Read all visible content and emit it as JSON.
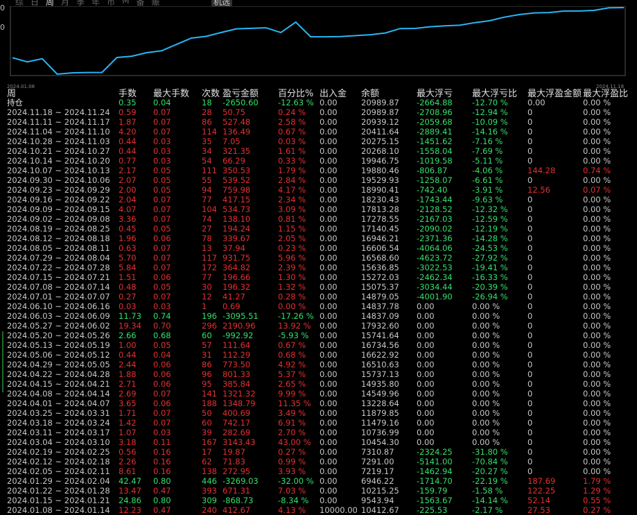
{
  "tabs": [
    "综",
    "日",
    "周",
    "月",
    "季",
    "年",
    "币",
    "M",
    "备",
    "赈"
  ],
  "active_tab_index": 2,
  "curve_label": "机选",
  "chart": {
    "start_date": "2024.01.08",
    "end_date": "2024.11.18",
    "line_color": "#29b6f6",
    "y_labels": [
      "0",
      "0"
    ]
  },
  "chart_data": {
    "type": "line",
    "x": [
      "2024.01.08",
      "2024.01.15",
      "2024.01.22",
      "2024.01.29",
      "2024.02.05",
      "2024.02.12",
      "2024.02.19",
      "2024.03.04",
      "2024.03.11",
      "2024.03.18",
      "2024.03.25",
      "2024.04.01",
      "2024.04.08",
      "2024.04.15",
      "2024.04.22",
      "2024.04.29",
      "2024.05.06",
      "2024.05.13",
      "2024.05.20",
      "2024.05.27",
      "2024.06.03",
      "2024.06.10",
      "2024.07.01",
      "2024.07.08",
      "2024.07.15",
      "2024.07.22",
      "2024.07.29",
      "2024.08.05",
      "2024.08.12",
      "2024.08.19",
      "2024.09.02",
      "2024.09.09",
      "2024.09.16",
      "2024.09.23",
      "2024.09.30",
      "2024.10.07",
      "2024.10.14",
      "2024.10.21",
      "2024.10.28",
      "2024.11.04",
      "2024.11.11",
      "2024.11.18"
    ],
    "series": [
      {
        "values": [
          10412.67,
          9543.94,
          10215.25,
          6946.22,
          7219.17,
          7291.0,
          7310.87,
          10454.3,
          10736.99,
          11479.16,
          11879.85,
          13228.64,
          14549.96,
          14935.8,
          15737.13,
          16510.63,
          16622.92,
          16734.56,
          15741.64,
          17932.6,
          14837.09,
          14837.78,
          14879.05,
          15075.37,
          15272.03,
          15636.85,
          16568.6,
          16606.54,
          16946.21,
          17140.45,
          17278.55,
          17813.28,
          18230.43,
          18990.41,
          19529.93,
          19880.46,
          19946.75,
          20268.1,
          20275.15,
          20411.64,
          20939.12,
          20989.87
        ]
      }
    ]
  },
  "table": {
    "headers": [
      "周",
      "手数",
      "最大手数",
      "次数",
      "盈亏金额",
      "百分比%",
      "出入金",
      "余额",
      "最大浮亏",
      "最大浮亏比",
      "最大浮盈金额",
      "最大浮盈比"
    ],
    "rows": [
      {
        "cls": "up",
        "fl_c": "g",
        "fp_c": "w",
        "d": "持仓",
        "lot": "0.35",
        "max": "0.04",
        "cnt": "18",
        "pnl": "-2650.60",
        "pct": "-12.63 %",
        "io": "0.00",
        "bal": "20989.87",
        "fl": "-2664.88",
        "flp": "-12.70 %",
        "fp": "0.00",
        "fpp": "0.00 %"
      },
      {
        "cls": "dn",
        "fl_c": "g",
        "fp_c": "w",
        "d": "2024.11.18 ~ 2024.11.24",
        "lot": "0.59",
        "max": "0.07",
        "cnt": "28",
        "pnl": "50.75",
        "pct": "0.24 %",
        "io": "0.00",
        "bal": "20989.87",
        "fl": "-2708.96",
        "flp": "-12.94 %",
        "fp": "0",
        "fpp": "0.00 %"
      },
      {
        "cls": "dn",
        "fl_c": "g",
        "fp_c": "w",
        "d": "2024.11.11 ~ 2024.11.17",
        "lot": "1.87",
        "max": "0.07",
        "cnt": "86",
        "pnl": "527.48",
        "pct": "2.58 %",
        "io": "0.00",
        "bal": "20939.12",
        "fl": "-2059.68",
        "flp": "-10.09 %",
        "fp": "0",
        "fpp": "0.00 %"
      },
      {
        "cls": "dn",
        "fl_c": "g",
        "fp_c": "w",
        "d": "2024.11.04 ~ 2024.11.10",
        "lot": "4.20",
        "max": "0.07",
        "cnt": "114",
        "pnl": "136.49",
        "pct": "0.67 %",
        "io": "0.00",
        "bal": "20411.64",
        "fl": "-2889.41",
        "flp": "-14.16 %",
        "fp": "0",
        "fpp": "0.00 %"
      },
      {
        "cls": "dn",
        "fl_c": "g",
        "fp_c": "w",
        "d": "2024.10.28 ~ 2024.11.03",
        "lot": "0.44",
        "max": "0.03",
        "cnt": "35",
        "pnl": "7.05",
        "pct": "0.03 %",
        "io": "0.00",
        "bal": "20275.15",
        "fl": "-1451.62",
        "flp": "-7.16 %",
        "fp": "0",
        "fpp": "0.00 %"
      },
      {
        "cls": "dn",
        "fl_c": "g",
        "fp_c": "w",
        "d": "2024.10.21 ~ 2024.10.27",
        "lot": "0.44",
        "max": "0.03",
        "cnt": "34",
        "pnl": "321.35",
        "pct": "1.61 %",
        "io": "0.00",
        "bal": "20268.10",
        "fl": "-1558.04",
        "flp": "-7.69 %",
        "fp": "0",
        "fpp": "0.00 %"
      },
      {
        "cls": "dn",
        "fl_c": "g",
        "fp_c": "w",
        "d": "2024.10.14 ~ 2024.10.20",
        "lot": "0.77",
        "max": "0.03",
        "cnt": "54",
        "pnl": "66.29",
        "pct": "0.33 %",
        "io": "0.00",
        "bal": "19946.75",
        "fl": "-1019.58",
        "flp": "-5.11 %",
        "fp": "0",
        "fpp": "0.00 %"
      },
      {
        "cls": "dn",
        "fl_c": "g",
        "fp_c": "r",
        "d": "2024.10.07 ~ 2024.10.13",
        "lot": "2.17",
        "max": "0.05",
        "cnt": "111",
        "pnl": "350.53",
        "pct": "1.79 %",
        "io": "0.00",
        "bal": "19880.46",
        "fl": "-806.87",
        "flp": "-4.06 %",
        "fp": "144.28",
        "fpp": "0.74 %"
      },
      {
        "cls": "dn",
        "fl_c": "g",
        "fp_c": "w",
        "d": "2024.09.30 ~ 2024.10.06",
        "lot": "2.07",
        "max": "0.05",
        "cnt": "55",
        "pnl": "539.52",
        "pct": "2.84 %",
        "io": "0.00",
        "bal": "19529.93",
        "fl": "-1258.07",
        "flp": "-6.61 %",
        "fp": "0",
        "fpp": "0.00 %"
      },
      {
        "cls": "dn",
        "fl_c": "g",
        "fp_c": "r",
        "d": "2024.09.23 ~ 2024.09.29",
        "lot": "2.00",
        "max": "0.05",
        "cnt": "94",
        "pnl": "759.98",
        "pct": "4.17 %",
        "io": "0.00",
        "bal": "18990.41",
        "fl": "-742.40",
        "flp": "-3.91 %",
        "fp": "12.56",
        "fpp": "0.07 %"
      },
      {
        "cls": "dn",
        "fl_c": "g",
        "fp_c": "w",
        "d": "2024.09.16 ~ 2024.09.22",
        "lot": "2.04",
        "max": "0.07",
        "cnt": "77",
        "pnl": "417.15",
        "pct": "2.34 %",
        "io": "0.00",
        "bal": "18230.43",
        "fl": "-1743.44",
        "flp": "-9.63 %",
        "fp": "0",
        "fpp": "0.00 %"
      },
      {
        "cls": "dn",
        "fl_c": "g",
        "fp_c": "w",
        "d": "2024.09.09 ~ 2024.09.15",
        "lot": "4.07",
        "max": "0.07",
        "cnt": "104",
        "pnl": "534.73",
        "pct": "3.09 %",
        "io": "0.00",
        "bal": "17813.28",
        "fl": "-2128.52",
        "flp": "-12.32 %",
        "fp": "0",
        "fpp": "0.00 %"
      },
      {
        "cls": "dn",
        "fl_c": "g",
        "fp_c": "w",
        "d": "2024.09.02 ~ 2024.09.08",
        "lot": "3.36",
        "max": "0.07",
        "cnt": "74",
        "pnl": "138.10",
        "pct": "0.81 %",
        "io": "0.00",
        "bal": "17278.55",
        "fl": "-2167.03",
        "flp": "-12.59 %",
        "fp": "0",
        "fpp": "0.00 %"
      },
      {
        "cls": "dn",
        "fl_c": "g",
        "fp_c": "w",
        "d": "2024.08.19 ~ 2024.08.25",
        "lot": "0.45",
        "max": "0.05",
        "cnt": "27",
        "pnl": "194.24",
        "pct": "1.15 %",
        "io": "0.00",
        "bal": "17140.45",
        "fl": "-2090.02",
        "flp": "-12.19 %",
        "fp": "0",
        "fpp": "0.00 %"
      },
      {
        "cls": "dn",
        "fl_c": "g",
        "fp_c": "w",
        "d": "2024.08.12 ~ 2024.08.18",
        "lot": "1.96",
        "max": "0.06",
        "cnt": "78",
        "pnl": "339.67",
        "pct": "2.05 %",
        "io": "0.00",
        "bal": "16946.21",
        "fl": "-2371.36",
        "flp": "-14.28 %",
        "fp": "0",
        "fpp": "0.00 %"
      },
      {
        "cls": "dn",
        "fl_c": "g",
        "fp_c": "w",
        "d": "2024.08.05 ~ 2024.08.11",
        "lot": "0.63",
        "max": "0.07",
        "cnt": "13",
        "pnl": "37.94",
        "pct": "0.23 %",
        "io": "0.00",
        "bal": "16606.54",
        "fl": "-4064.06",
        "flp": "-24.53 %",
        "fp": "0",
        "fpp": "0.00 %"
      },
      {
        "cls": "dn",
        "fl_c": "g",
        "fp_c": "w",
        "d": "2024.07.29 ~ 2024.08.04",
        "lot": "5.70",
        "max": "0.07",
        "cnt": "117",
        "pnl": "931.75",
        "pct": "5.96 %",
        "io": "0.00",
        "bal": "16568.60",
        "fl": "-4623.72",
        "flp": "-27.92 %",
        "fp": "0",
        "fpp": "0.00 %"
      },
      {
        "cls": "dn",
        "fl_c": "g",
        "fp_c": "w",
        "d": "2024.07.22 ~ 2024.07.28",
        "lot": "5.84",
        "max": "0.07",
        "cnt": "172",
        "pnl": "364.82",
        "pct": "2.39 %",
        "io": "0.00",
        "bal": "15636.85",
        "fl": "-3022.53",
        "flp": "-19.41 %",
        "fp": "0",
        "fpp": "0.00 %"
      },
      {
        "cls": "dn",
        "fl_c": "g",
        "fp_c": "w",
        "d": "2024.07.15 ~ 2024.07.21",
        "lot": "1.51",
        "max": "0.06",
        "cnt": "77",
        "pnl": "196.66",
        "pct": "1.30 %",
        "io": "0.00",
        "bal": "15272.03",
        "fl": "-2462.34",
        "flp": "-16.33 %",
        "fp": "0",
        "fpp": "0.00 %"
      },
      {
        "cls": "dn",
        "fl_c": "g",
        "fp_c": "w",
        "d": "2024.07.08 ~ 2024.07.14",
        "lot": "0.48",
        "max": "0.05",
        "cnt": "30",
        "pnl": "196.32",
        "pct": "1.32 %",
        "io": "0.00",
        "bal": "15075.37",
        "fl": "-3034.44",
        "flp": "-20.39 %",
        "fp": "0",
        "fpp": "0.00 %"
      },
      {
        "cls": "dn",
        "fl_c": "g",
        "fp_c": "w",
        "d": "2024.07.01 ~ 2024.07.07",
        "lot": "0.27",
        "max": "0.07",
        "cnt": "12",
        "pnl": "41.27",
        "pct": "0.28 %",
        "io": "0.00",
        "bal": "14879.05",
        "fl": "-4001.90",
        "flp": "-26.94 %",
        "fp": "0",
        "fpp": "0.00 %"
      },
      {
        "cls": "dn",
        "fl_c": "w",
        "fp_c": "w",
        "d": "2024.06.10 ~ 2024.06.16",
        "lot": "0.03",
        "max": "0.03",
        "cnt": "1",
        "pnl": "0.69",
        "pct": "0.00 %",
        "io": "0.00",
        "bal": "14837.78",
        "fl": "0.00",
        "flp": "0.00 %",
        "fp": "0",
        "fpp": "0.00 %"
      },
      {
        "cls": "up",
        "fl_c": "w",
        "fp_c": "w",
        "d": "2024.06.03 ~ 2024.06.09",
        "lot": "11.73",
        "max": "0.74",
        "cnt": "196",
        "pnl": "-3095.51",
        "pct": "-17.26 %",
        "io": "0.00",
        "bal": "14837.09",
        "fl": "0.00",
        "flp": "0.00 %",
        "fp": "0",
        "fpp": "0.00 %"
      },
      {
        "cls": "dn",
        "fl_c": "w",
        "fp_c": "w",
        "d": "2024.05.27 ~ 2024.06.02",
        "lot": "19.34",
        "max": "0.70",
        "cnt": "296",
        "pnl": "2190.96",
        "pct": "13.92 %",
        "io": "0.00",
        "bal": "17932.60",
        "fl": "0.00",
        "flp": "0.00 %",
        "fp": "0",
        "fpp": "0.00 %"
      },
      {
        "cls": "up",
        "fl_c": "w",
        "fp_c": "w",
        "d": "2024.05.20 ~ 2024.05.26",
        "lot": "2.66",
        "max": "0.68",
        "cnt": "60",
        "pnl": "-992.92",
        "pct": "-5.93 %",
        "io": "0.00",
        "bal": "15741.64",
        "fl": "0.00",
        "flp": "0.00 %",
        "fp": "0",
        "fpp": "0.00 %"
      },
      {
        "cls": "dn",
        "fl_c": "w",
        "fp_c": "w",
        "d": "2024.05.13 ~ 2024.05.19",
        "lot": "1.00",
        "max": "0.05",
        "cnt": "57",
        "pnl": "111.64",
        "pct": "0.67 %",
        "io": "0.00",
        "bal": "16734.56",
        "fl": "0.00",
        "flp": "0.00 %",
        "fp": "0",
        "fpp": "0.00 %"
      },
      {
        "cls": "dn",
        "fl_c": "w",
        "fp_c": "w",
        "d": "2024.05.06 ~ 2024.05.12",
        "lot": "0.44",
        "max": "0.04",
        "cnt": "31",
        "pnl": "112.29",
        "pct": "0.68 %",
        "io": "0.00",
        "bal": "16622.92",
        "fl": "0.00",
        "flp": "0.00 %",
        "fp": "0",
        "fpp": "0.00 %"
      },
      {
        "cls": "dn",
        "fl_c": "w",
        "fp_c": "w",
        "d": "2024.04.29 ~ 2024.05.05",
        "lot": "2.44",
        "max": "0.06",
        "cnt": "86",
        "pnl": "773.50",
        "pct": "4.92 %",
        "io": "0.00",
        "bal": "16510.63",
        "fl": "0.00",
        "flp": "0.00 %",
        "fp": "0",
        "fpp": "0.00 %"
      },
      {
        "cls": "dn",
        "fl_c": "w",
        "fp_c": "w",
        "d": "2024.04.22 ~ 2024.04.28",
        "lot": "1.88",
        "max": "0.06",
        "cnt": "96",
        "pnl": "801.33",
        "pct": "5.37 %",
        "io": "0.00",
        "bal": "15737.13",
        "fl": "0.00",
        "flp": "0.00 %",
        "fp": "0",
        "fpp": "0.00 %"
      },
      {
        "cls": "dn",
        "fl_c": "w",
        "fp_c": "w",
        "d": "2024.04.15 ~ 2024.04.21",
        "lot": "2.71",
        "max": "0.06",
        "cnt": "95",
        "pnl": "385.84",
        "pct": "2.65 %",
        "io": "0.00",
        "bal": "14935.80",
        "fl": "0.00",
        "flp": "0.00 %",
        "fp": "0",
        "fpp": "0.00 %"
      },
      {
        "cls": "dn",
        "fl_c": "w",
        "fp_c": "w",
        "d": "2024.04.08 ~ 2024.04.14",
        "lot": "2.69",
        "max": "0.07",
        "cnt": "141",
        "pnl": "1321.32",
        "pct": "9.99 %",
        "io": "0.00",
        "bal": "14549.96",
        "fl": "0.00",
        "flp": "0.00 %",
        "fp": "0",
        "fpp": "0.00 %"
      },
      {
        "cls": "dn",
        "fl_c": "w",
        "fp_c": "w",
        "d": "2024.04.01 ~ 2024.04.07",
        "lot": "3.65",
        "max": "0.06",
        "cnt": "188",
        "pnl": "1348.79",
        "pct": "11.35 %",
        "io": "0.00",
        "bal": "13228.64",
        "fl": "0.00",
        "flp": "0.00 %",
        "fp": "0",
        "fpp": "0.00 %"
      },
      {
        "cls": "dn",
        "fl_c": "w",
        "fp_c": "w",
        "d": "2024.03.25 ~ 2024.03.31",
        "lot": "1.71",
        "max": "0.07",
        "cnt": "50",
        "pnl": "400.69",
        "pct": "3.49 %",
        "io": "0.00",
        "bal": "11879.85",
        "fl": "0.00",
        "flp": "0.00 %",
        "fp": "0",
        "fpp": "0.00 %"
      },
      {
        "cls": "dn",
        "fl_c": "w",
        "fp_c": "w",
        "d": "2024.03.18 ~ 2024.03.24",
        "lot": "1.42",
        "max": "0.07",
        "cnt": "60",
        "pnl": "742.17",
        "pct": "6.91 %",
        "io": "0.00",
        "bal": "11479.16",
        "fl": "0.00",
        "flp": "0.00 %",
        "fp": "0",
        "fpp": "0.00 %"
      },
      {
        "cls": "dn",
        "fl_c": "w",
        "fp_c": "w",
        "d": "2024.03.11 ~ 2024.03.17",
        "lot": "1.07",
        "max": "0.03",
        "cnt": "39",
        "pnl": "282.69",
        "pct": "2.70 %",
        "io": "0.00",
        "bal": "10736.99",
        "fl": "0.00",
        "flp": "0.00 %",
        "fp": "0",
        "fpp": "0.00 %"
      },
      {
        "cls": "dn",
        "fl_c": "w",
        "fp_c": "w",
        "d": "2024.03.04 ~ 2024.03.10",
        "lot": "3.18",
        "max": "0.11",
        "cnt": "167",
        "pnl": "3143.43",
        "pct": "43.00 %",
        "io": "0.00",
        "bal": "10454.30",
        "fl": "0.00",
        "flp": "0.00 %",
        "fp": "0",
        "fpp": "0.00 %"
      },
      {
        "cls": "dn",
        "fl_c": "g",
        "fp_c": "w",
        "d": "2024.02.19 ~ 2024.02.25",
        "lot": "0.56",
        "max": "0.16",
        "cnt": "17",
        "pnl": "19.87",
        "pct": "0.27 %",
        "io": "0.00",
        "bal": "7310.87",
        "fl": "-2324.25",
        "flp": "-31.80 %",
        "fp": "0",
        "fpp": "0.00 %"
      },
      {
        "cls": "dn",
        "fl_c": "g",
        "fp_c": "w",
        "d": "2024.02.12 ~ 2024.02.18",
        "lot": "2.26",
        "max": "0.16",
        "cnt": "62",
        "pnl": "71.83",
        "pct": "0.99 %",
        "io": "0.00",
        "bal": "7291.00",
        "fl": "-5141.00",
        "flp": "-70.84 %",
        "fp": "0",
        "fpp": "0.00 %"
      },
      {
        "cls": "dn",
        "fl_c": "g",
        "fp_c": "w",
        "d": "2024.02.05 ~ 2024.02.11",
        "lot": "8.61",
        "max": "0.16",
        "cnt": "138",
        "pnl": "272.95",
        "pct": "3.93 %",
        "io": "0.00",
        "bal": "7219.17",
        "fl": "-1462.94",
        "flp": "-20.27 %",
        "fp": "0",
        "fpp": "0.00 %"
      },
      {
        "cls": "up",
        "fl_c": "g",
        "fp_c": "r",
        "d": "2024.01.29 ~ 2024.02.04",
        "lot": "42.47",
        "max": "0.80",
        "cnt": "446",
        "pnl": "-3269.03",
        "pct": "-32.00 %",
        "io": "0.00",
        "bal": "6946.22",
        "fl": "-1714.70",
        "flp": "-22.19 %",
        "fp": "187.69",
        "fpp": "1.79 %"
      },
      {
        "cls": "dn",
        "fl_c": "g",
        "fp_c": "r",
        "d": "2024.01.22 ~ 2024.01.28",
        "lot": "13.47",
        "max": "0.47",
        "cnt": "393",
        "pnl": "671.31",
        "pct": "7.03 %",
        "io": "0.00",
        "bal": "10215.25",
        "fl": "-159.79",
        "flp": "-1.58 %",
        "fp": "122.25",
        "fpp": "1.29 %"
      },
      {
        "cls": "up",
        "fl_c": "g",
        "fp_c": "r",
        "d": "2024.01.15 ~ 2024.01.21",
        "lot": "24.86",
        "max": "0.80",
        "cnt": "309",
        "pnl": "-868.73",
        "pct": "-8.34 %",
        "io": "0.00",
        "bal": "9543.94",
        "fl": "-1563.67",
        "flp": "-14.14 %",
        "fp": "52.14",
        "fpp": "0.55 %"
      },
      {
        "cls": "dn",
        "fl_c": "g",
        "fp_c": "r",
        "d": "2024.01.08 ~ 2024.01.14",
        "lot": "12.23",
        "max": "0.47",
        "cnt": "240",
        "pnl": "412.67",
        "pct": "4.13 %",
        "io": "10000.00",
        "bal": "10412.67",
        "fl": "-225.53",
        "flp": "-2.17 %",
        "fp": "27.53",
        "fpp": "0.27 %"
      }
    ]
  }
}
